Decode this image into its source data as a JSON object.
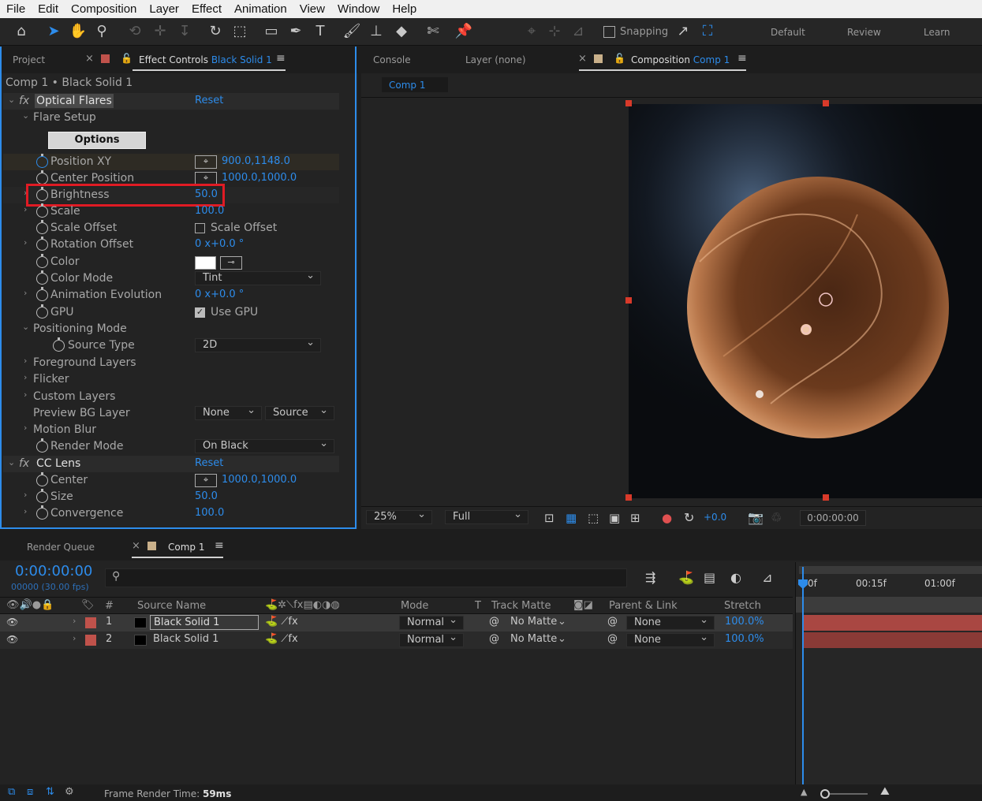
{
  "menu": [
    "File",
    "Edit",
    "Composition",
    "Layer",
    "Effect",
    "Animation",
    "View",
    "Window",
    "Help"
  ],
  "toolbar": {
    "snapping_label": "Snapping",
    "workspaces": [
      "Default",
      "Review",
      "Learn"
    ]
  },
  "left_panel": {
    "tabs": {
      "project": "Project",
      "effect_controls": "Effect Controls",
      "effect_target": "Black Solid 1"
    },
    "breadcrumb": "Comp 1 • Black Solid 1",
    "fx1": {
      "name": "Optical Flares",
      "reset": "Reset"
    },
    "flare_setup": "Flare Setup",
    "options_button": "Options",
    "props": {
      "position_xy": {
        "label": "Position XY",
        "value": "900.0,1148.0"
      },
      "center_position": {
        "label": "Center Position",
        "value": "1000.0,1000.0"
      },
      "brightness": {
        "label": "Brightness",
        "value": "50.0"
      },
      "scale": {
        "label": "Scale",
        "value": "100.0"
      },
      "scale_offset": {
        "label": "Scale Offset",
        "check_label": "Scale Offset"
      },
      "rotation_offset": {
        "label": "Rotation Offset",
        "value": "0 x+0.0 °"
      },
      "color": {
        "label": "Color"
      },
      "color_mode": {
        "label": "Color Mode",
        "value": "Tint"
      },
      "animation_evolution": {
        "label": "Animation Evolution",
        "value": "0 x+0.0 °"
      },
      "gpu": {
        "label": "GPU",
        "check_label": "Use GPU"
      },
      "positioning_mode": "Positioning Mode",
      "source_type": {
        "label": "Source Type",
        "value": "2D"
      },
      "foreground_layers": "Foreground Layers",
      "flicker": "Flicker",
      "custom_layers": "Custom Layers",
      "preview_bg": {
        "label": "Preview BG Layer",
        "value1": "None",
        "value2": "Source"
      },
      "motion_blur": "Motion Blur",
      "render_mode": {
        "label": "Render Mode",
        "value": "On Black"
      }
    },
    "fx2": {
      "name": "CC Lens",
      "reset": "Reset"
    },
    "lens_props": {
      "center": {
        "label": "Center",
        "value": "1000.0,1000.0"
      },
      "size": {
        "label": "Size",
        "value": "50.0"
      },
      "convergence": {
        "label": "Convergence",
        "value": "100.0"
      }
    }
  },
  "comp_panel": {
    "tabs": {
      "console": "Console",
      "layer": "Layer (none)",
      "composition": "Composition",
      "comp_name": "Comp 1"
    },
    "subtab": "Comp 1",
    "zoom": "25%",
    "resolution": "Full",
    "exposure": "+0.0",
    "timecode": "0:00:00:00"
  },
  "timeline": {
    "tabs": {
      "render_queue": "Render Queue",
      "comp": "Comp 1"
    },
    "current_time": "0:00:00:00",
    "frames": "00000 (30.00 fps)",
    "headers": {
      "num": "#",
      "source": "Source Name",
      "mode": "Mode",
      "t": "T",
      "track_matte": "Track Matte",
      "parent": "Parent & Link",
      "stretch": "Stretch"
    },
    "ruler": [
      "0f",
      "00:15f",
      "01:00f"
    ],
    "layers": [
      {
        "num": "1",
        "name": "Black Solid 1",
        "mode": "Normal",
        "matte": "No Matte",
        "parent": "None",
        "stretch": "100.0%"
      },
      {
        "num": "2",
        "name": "Black Solid 1",
        "mode": "Normal",
        "matte": "No Matte",
        "parent": "None",
        "stretch": "100.0%"
      }
    ],
    "status_label": "Frame Render Time:",
    "status_value": "59ms"
  },
  "colors": {
    "accent": "#2d8ceb",
    "highlight": "#e01b24",
    "layer_label": "#c0524b"
  }
}
